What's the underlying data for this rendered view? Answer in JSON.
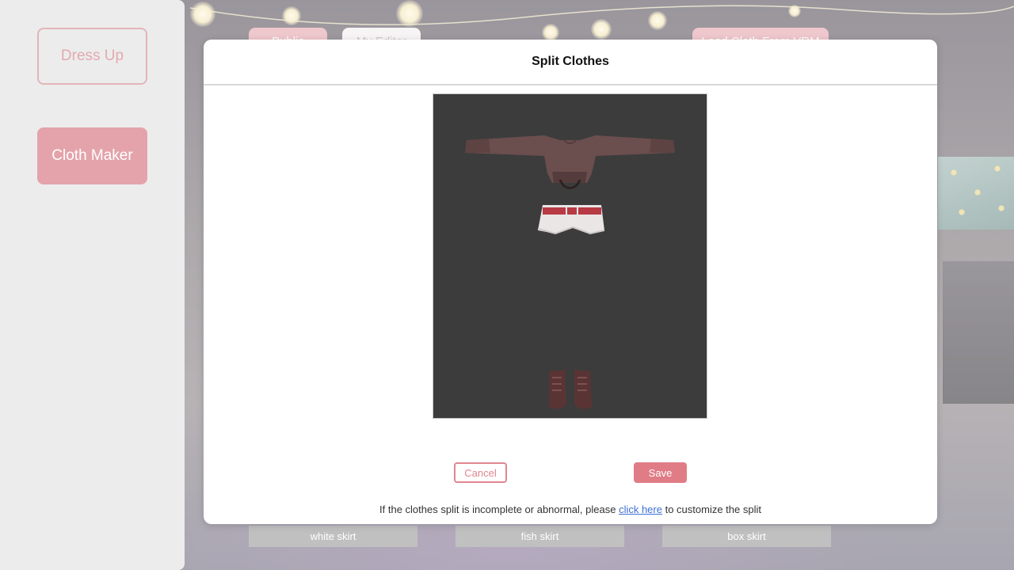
{
  "background": {
    "top_buttons": {
      "public_label": "Public",
      "my_editor_label": "My Editor",
      "load_label": "Load Cloth From VRM"
    },
    "skirts": [
      {
        "label": "white skirt"
      },
      {
        "label": "fish skirt"
      },
      {
        "label": "box skirt"
      }
    ]
  },
  "sidebar": {
    "items": [
      {
        "label": "Dress Up",
        "active": false
      },
      {
        "label": "Cloth Maker",
        "active": true
      }
    ]
  },
  "modal": {
    "title": "Split Clothes",
    "preview": {
      "items": [
        "sweater",
        "shorts",
        "boots"
      ]
    },
    "cancel_label": "Cancel",
    "save_label": "Save",
    "note_before": "If the clothes split is incomplete or abnormal, please ",
    "note_link": "click here",
    "note_after": " to customize the split"
  },
  "colors": {
    "accent": "#e07c86",
    "sidebar_active": "#e4a3aa",
    "preview_bg": "#3c3c3c",
    "link": "#3d6fd6"
  }
}
